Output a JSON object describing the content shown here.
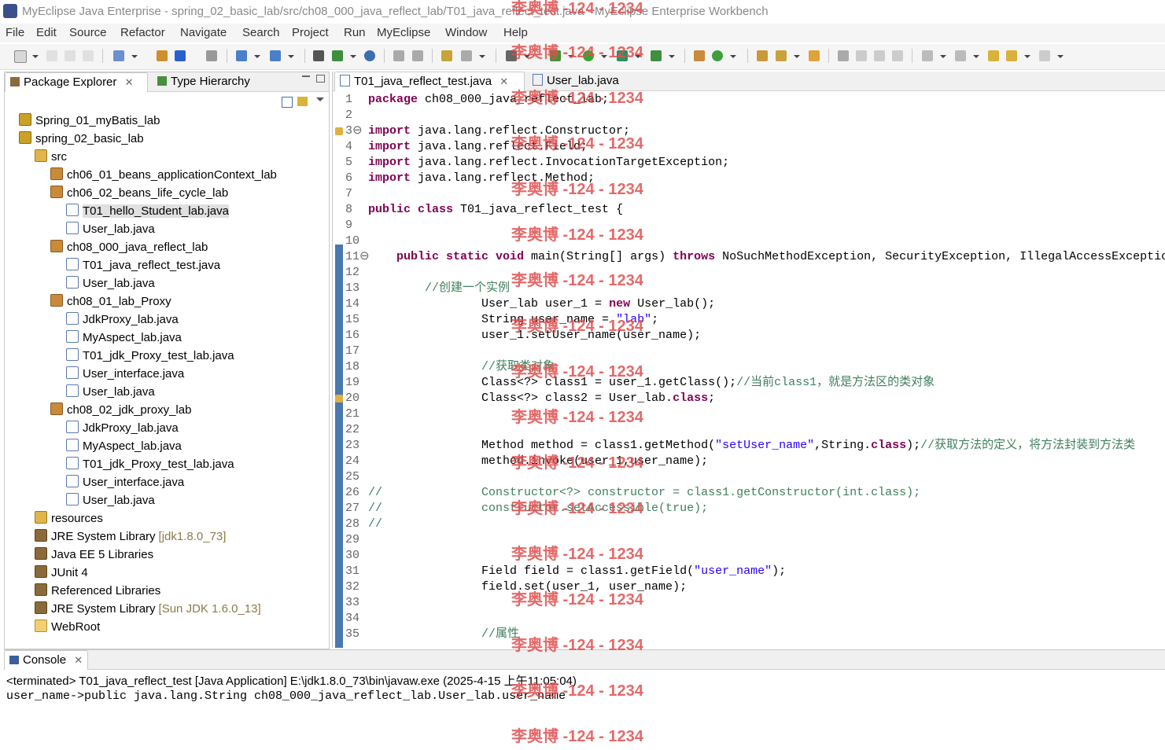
{
  "window": {
    "title": "MyEclipse Java Enterprise - spring_02_basic_lab/src/ch08_000_java_reflect_lab/T01_java_reflect_test.java - MyEclipse Enterprise Workbench"
  },
  "menu": [
    "File",
    "Edit",
    "Source",
    "Refactor",
    "Navigate",
    "Search",
    "Project",
    "Run",
    "MyEclipse",
    "Window",
    "Help"
  ],
  "left_panel": {
    "tab_package_explorer": "Package Explorer",
    "tab_type_hierarchy": "Type Hierarchy",
    "tree": [
      {
        "label": "Spring_01_myBatis_lab",
        "icon": "project-icon"
      },
      {
        "label": "spring_02_basic_lab",
        "icon": "project-icon"
      },
      {
        "label": "src",
        "icon": "source-folder-icon"
      },
      {
        "label": "ch06_01_beans_applicationContext_lab",
        "icon": "package-icon"
      },
      {
        "label": "ch06_02_beans_life_cycle_lab",
        "icon": "package-icon"
      },
      {
        "label": "T01_hello_Student_lab.java",
        "icon": "java-file-icon"
      },
      {
        "label": "User_lab.java",
        "icon": "java-file-icon"
      },
      {
        "label": "ch08_000_java_reflect_lab",
        "icon": "package-icon"
      },
      {
        "label": "T01_java_reflect_test.java",
        "icon": "java-file-icon"
      },
      {
        "label": "User_lab.java",
        "icon": "java-file-icon"
      },
      {
        "label": "ch08_01_lab_Proxy",
        "icon": "package-icon"
      },
      {
        "label": "JdkProxy_lab.java",
        "icon": "java-file-icon"
      },
      {
        "label": "MyAspect_lab.java",
        "icon": "java-file-icon"
      },
      {
        "label": "T01_jdk_Proxy_test_lab.java",
        "icon": "java-file-icon"
      },
      {
        "label": "User_interface.java",
        "icon": "java-file-icon"
      },
      {
        "label": "User_lab.java",
        "icon": "java-file-icon"
      },
      {
        "label": "ch08_02_jdk_proxy_lab",
        "icon": "package-icon"
      },
      {
        "label": "JdkProxy_lab.java",
        "icon": "java-file-icon"
      },
      {
        "label": "MyAspect_lab.java",
        "icon": "java-file-icon"
      },
      {
        "label": "T01_jdk_Proxy_test_lab.java",
        "icon": "java-file-icon"
      },
      {
        "label": "User_interface.java",
        "icon": "java-file-icon"
      },
      {
        "label": "User_lab.java",
        "icon": "java-file-icon"
      },
      {
        "label": "resources",
        "icon": "source-folder-icon"
      },
      {
        "label": "JRE System Library",
        "suffix": "[jdk1.8.0_73]",
        "icon": "library-icon"
      },
      {
        "label": "Java EE 5 Libraries",
        "icon": "library-icon"
      },
      {
        "label": "JUnit 4",
        "icon": "library-icon"
      },
      {
        "label": "Referenced Libraries",
        "icon": "library-icon"
      },
      {
        "label": "JRE System Library",
        "suffix": "[Sun JDK 1.6.0_13]",
        "icon": "library-icon"
      },
      {
        "label": "WebRoot",
        "icon": "folder-icon"
      }
    ]
  },
  "editor": {
    "tabs": [
      "T01_java_reflect_test.java",
      "User_lab.java"
    ],
    "lines": [
      {
        "n": "1",
        "html": "<span class='kw'>package</span> ch08_000_java_reflect_lab;"
      },
      {
        "n": "2",
        "html": ""
      },
      {
        "n": "3⊖",
        "html": "<span class='kw'>import</span> java.lang.reflect.Constructor;"
      },
      {
        "n": "4",
        "html": "<span class='kw'>import</span> java.lang.reflect.Field;"
      },
      {
        "n": "5",
        "html": "<span class='kw'>import</span> java.lang.reflect.InvocationTargetException;"
      },
      {
        "n": "6",
        "html": "<span class='kw'>import</span> java.lang.reflect.Method;"
      },
      {
        "n": "7",
        "html": ""
      },
      {
        "n": "8",
        "html": "<span class='kw'>public class</span> T01_java_reflect_test {"
      },
      {
        "n": "9",
        "html": ""
      },
      {
        "n": "10",
        "html": ""
      },
      {
        "n": "11⊖",
        "html": "    <span class='kw'>public static void</span> main(String[] args) <span class='kw'>throws</span> NoSuchMethodException, SecurityException, IllegalAccessExceptio"
      },
      {
        "n": "12",
        "html": ""
      },
      {
        "n": "13",
        "html": "        <span class='cmt'>//创建一个实例</span>"
      },
      {
        "n": "14",
        "html": "                User_lab user_1 = <span class='kw'>new</span> User_lab();"
      },
      {
        "n": "15",
        "html": "                String user_name = <span class='str'>\"lab\"</span>;"
      },
      {
        "n": "16",
        "html": "                user_1.setUser_name(user_name);"
      },
      {
        "n": "17",
        "html": ""
      },
      {
        "n": "18",
        "html": "                <span class='cmt'>//获取类对象</span>"
      },
      {
        "n": "19",
        "html": "                Class&lt;?&gt; class1 = user_1.getClass();<span class='cmt'>//当前class1，就是方法区的类对象</span>"
      },
      {
        "n": "20",
        "html": "                Class&lt;?&gt; class2 = User_lab.<span class='kw'>class</span>;"
      },
      {
        "n": "21",
        "html": ""
      },
      {
        "n": "22",
        "html": ""
      },
      {
        "n": "23",
        "html": "                Method method = class1.getMethod(<span class='str'>\"setUser_name\"</span>,String.<span class='kw'>class</span>);<span class='cmt'>//获取方法的定义，将方法封装到方法类</span>"
      },
      {
        "n": "24",
        "html": "                method.invoke(user_1,user_name);"
      },
      {
        "n": "25",
        "html": ""
      },
      {
        "n": "26",
        "html": "<span class='cmt'>//              Constructor&lt;?&gt; constructor = class1.getConstructor(int.class);</span>"
      },
      {
        "n": "27",
        "html": "<span class='cmt'>//              constructor.setAccessible(true);</span>"
      },
      {
        "n": "28",
        "html": "<span class='cmt'>//</span>"
      },
      {
        "n": "29",
        "html": ""
      },
      {
        "n": "30",
        "html": ""
      },
      {
        "n": "31",
        "html": "                Field field = class1.getField(<span class='str'>\"user_name\"</span>);"
      },
      {
        "n": "32",
        "html": "                field.set(user_1, user_name);"
      },
      {
        "n": "33",
        "html": ""
      },
      {
        "n": "34",
        "html": ""
      },
      {
        "n": "35",
        "html": "                <span class='cmt'>//属性</span>"
      }
    ]
  },
  "console": {
    "tab": "Console",
    "status": "<terminated> T01_java_reflect_test [Java Application] E:\\jdk1.8.0_73\\bin\\javaw.exe (2025-4-15 上午11:05:04)",
    "output": "user_name->public java.lang.String ch08_000_java_reflect_lab.User_lab.user_name"
  },
  "watermark": "李奥博 -124 - 1234"
}
